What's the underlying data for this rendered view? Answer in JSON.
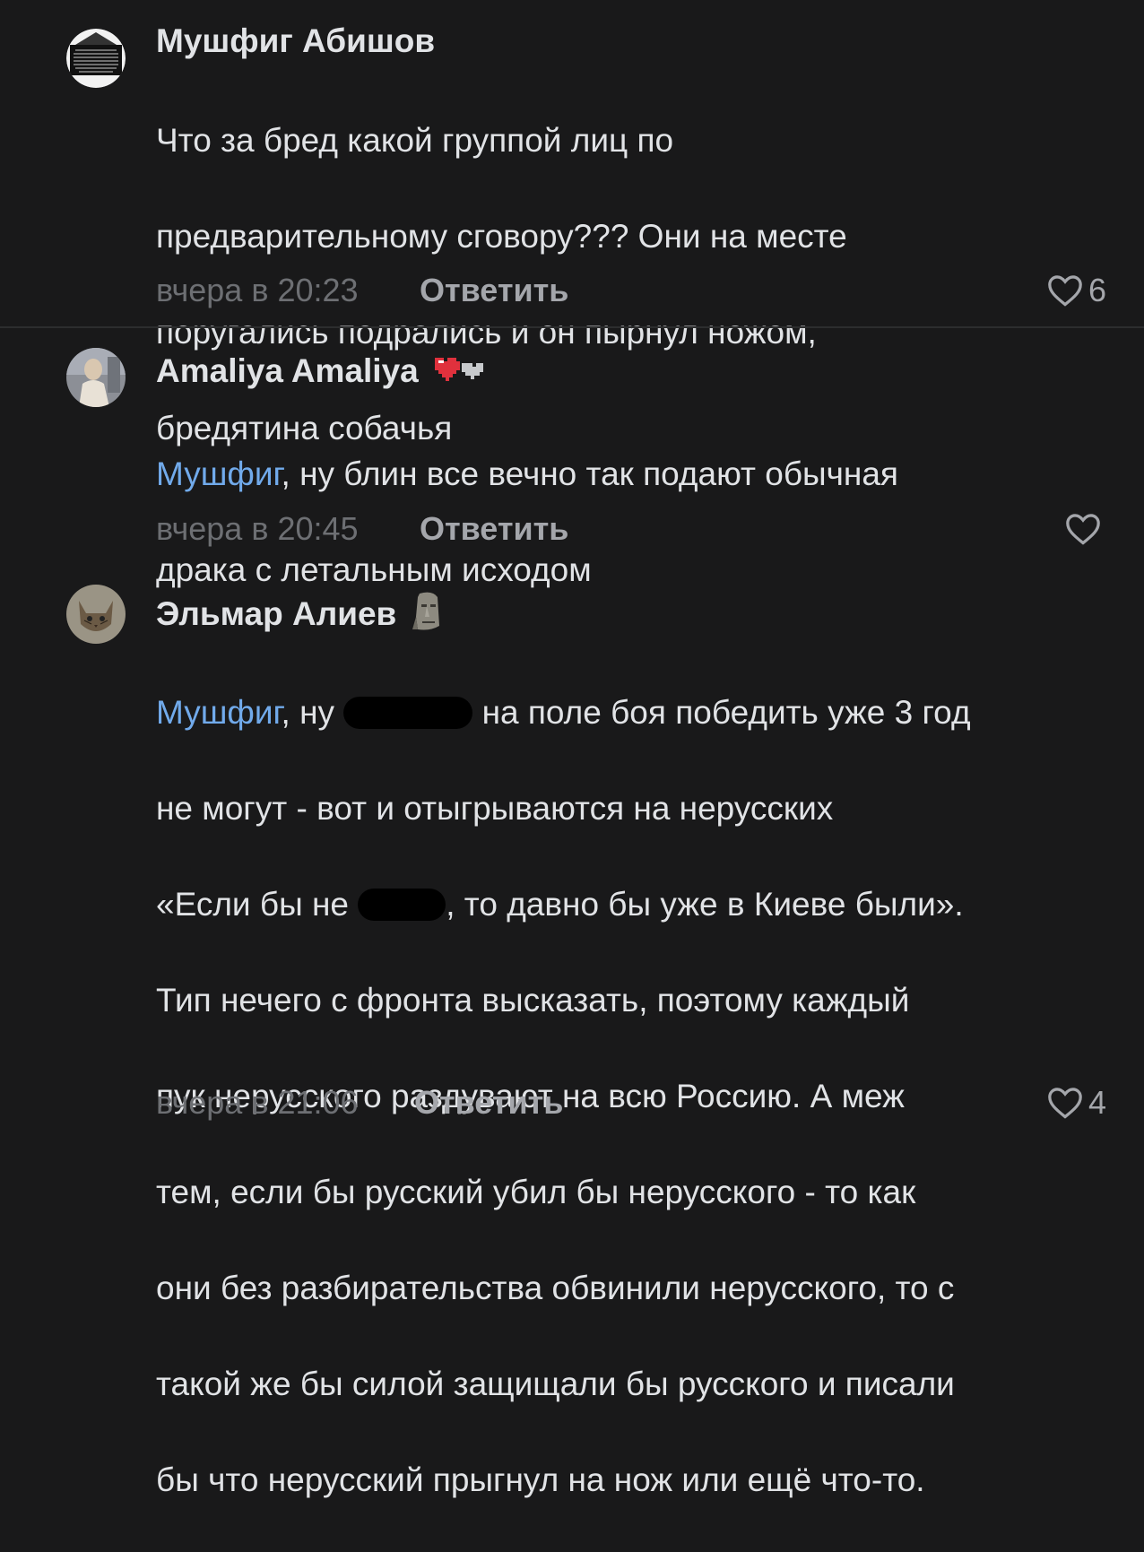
{
  "comments": [
    {
      "author": "Мушфиг Абишов",
      "lines": [
        "Что за бред какой группой лиц по",
        "предварительному сговору??? Они на месте",
        "поругались подрались и он пырнул ножом,",
        "бредятина собачья"
      ],
      "time": "вчера в 20:23",
      "reply_label": "Ответить",
      "likes": "6"
    },
    {
      "author": "Amaliya Amaliya",
      "mention": "Мушфиг",
      "text_after_mention": ", ну блин все вечно так подают обычная",
      "line2": "драка с летальным исходом",
      "time": "вчера в 20:45",
      "reply_label": "Ответить",
      "likes": ""
    },
    {
      "author": "Эльмар Алиев",
      "mention": "Мушфиг",
      "seg1": ", ну",
      "seg2": "на поле боя победить уже 3 год",
      "line2": "не могут - вот и отыгрываются на нерусских",
      "line3a": "«Если бы не",
      "line3b": ", то давно бы уже в Киеве были».",
      "rest_lines": [
        "Тип нечего с фронта высказать, поэтому каждый",
        "пук нерусского раздувают на всю Россию. А меж",
        "тем, если бы русский убил бы нерусского - то как",
        "они без разбирательства обвинили нерусского, то с",
        "такой же бы силой защищали бы русского и писали",
        "бы что нерусский прыгнул на нож или ещё что-то."
      ],
      "time": "вчера в 21:06",
      "reply_label": "Ответить",
      "likes": "4"
    }
  ],
  "colors": {
    "background": "#19191a",
    "mention": "#71aaeb",
    "secondary": "#6d6f73"
  }
}
